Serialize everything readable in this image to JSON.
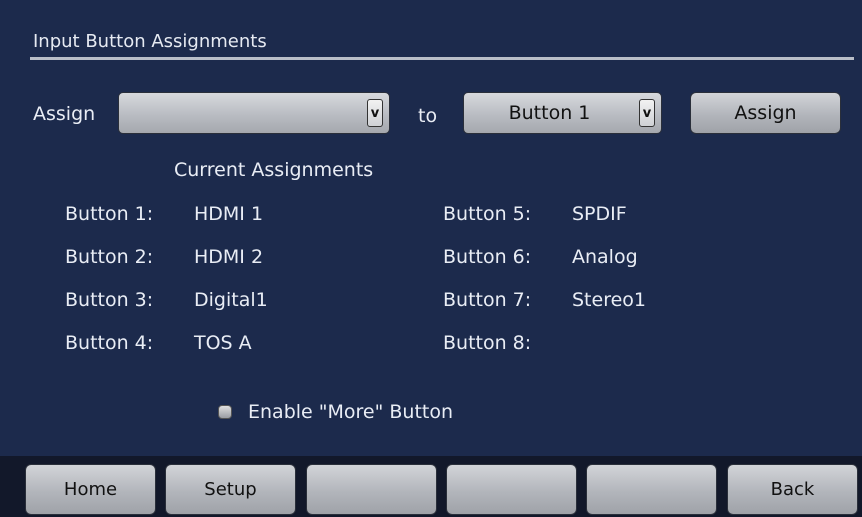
{
  "header": {
    "title": "Input Button Assignments"
  },
  "assign_row": {
    "assign_label": "Assign",
    "source_select_value": "",
    "to_label": "to",
    "button_select_value": "Button 1",
    "assign_button_label": "Assign",
    "dropdown_glyph": "v"
  },
  "current_assignments": {
    "heading": "Current Assignments",
    "items": [
      {
        "label": "Button 1:",
        "value": "HDMI 1"
      },
      {
        "label": "Button 2:",
        "value": "HDMI 2"
      },
      {
        "label": "Button 3:",
        "value": "Digital1"
      },
      {
        "label": "Button 4:",
        "value": "TOS A"
      },
      {
        "label": "Button 5:",
        "value": "SPDIF"
      },
      {
        "label": "Button 6:",
        "value": "Analog"
      },
      {
        "label": "Button 7:",
        "value": "Stereo1"
      },
      {
        "label": "Button 8:",
        "value": ""
      }
    ]
  },
  "options": {
    "enable_more_label": "Enable \"More\" Button",
    "enable_more_checked": false
  },
  "bottom_bar": {
    "buttons": [
      {
        "label": "Home"
      },
      {
        "label": "Setup"
      },
      {
        "label": ""
      },
      {
        "label": ""
      },
      {
        "label": ""
      },
      {
        "label": "Back"
      }
    ]
  },
  "colors": {
    "background": "#1c2a4c",
    "bar": "#12182a",
    "button": "#b9bcc2",
    "text": "#e9edf5"
  }
}
